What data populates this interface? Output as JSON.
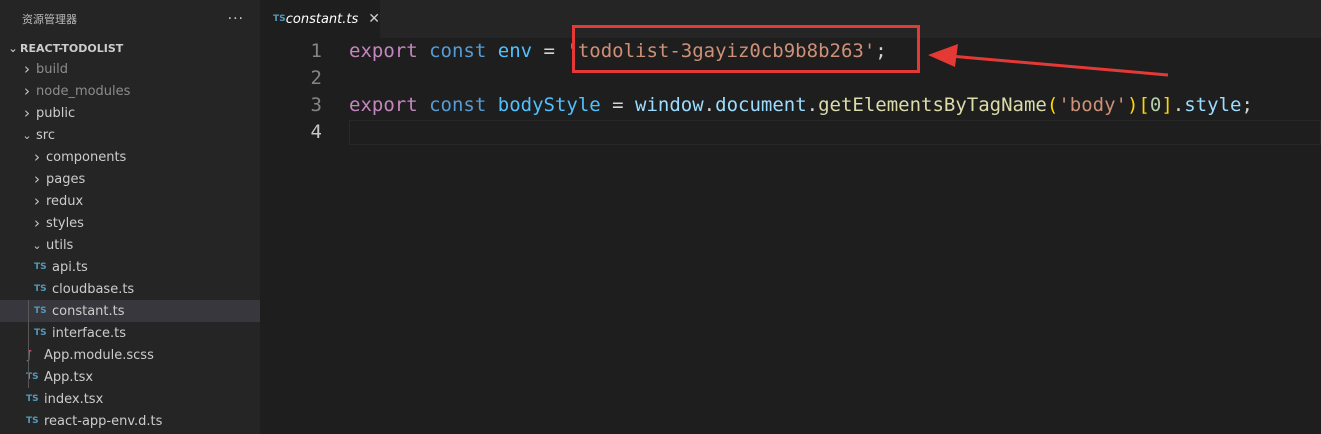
{
  "sidebar": {
    "title": "资源管理器",
    "more": "···",
    "project": "REACT-TODOLIST",
    "items": [
      {
        "label": "build",
        "kind": "folder",
        "open": false
      },
      {
        "label": "node_modules",
        "kind": "folder",
        "open": false
      },
      {
        "label": "public",
        "kind": "folder",
        "open": false
      },
      {
        "label": "src",
        "kind": "folder",
        "open": true
      },
      {
        "label": "components",
        "kind": "folder",
        "open": false
      },
      {
        "label": "pages",
        "kind": "folder",
        "open": false
      },
      {
        "label": "redux",
        "kind": "folder",
        "open": false
      },
      {
        "label": "styles",
        "kind": "folder",
        "open": false
      },
      {
        "label": "utils",
        "kind": "folder",
        "open": true
      },
      {
        "label": "api.ts",
        "kind": "ts"
      },
      {
        "label": "cloudbase.ts",
        "kind": "ts"
      },
      {
        "label": "constant.ts",
        "kind": "ts",
        "selected": true
      },
      {
        "label": "interface.ts",
        "kind": "ts"
      },
      {
        "label": "App.module.scss",
        "kind": "scss"
      },
      {
        "label": "App.tsx",
        "kind": "ts"
      },
      {
        "label": "index.tsx",
        "kind": "ts"
      },
      {
        "label": "react-app-env.d.ts",
        "kind": "ts"
      }
    ]
  },
  "editor": {
    "tab": {
      "badge": "TS",
      "title": "constant.ts",
      "close": "✕"
    },
    "lines": [
      {
        "num": "1",
        "tokens": [
          {
            "t": "export",
            "c": "kw-ex"
          },
          {
            "t": " ",
            "c": "punct"
          },
          {
            "t": "const",
            "c": "kw"
          },
          {
            "t": " ",
            "c": "punct"
          },
          {
            "t": "env",
            "c": "var"
          },
          {
            "t": " = ",
            "c": "punct"
          },
          {
            "t": "'todolist-3gayiz0cb9b8b263'",
            "c": "str"
          },
          {
            "t": ";",
            "c": "punct"
          }
        ]
      },
      {
        "num": "2",
        "tokens": []
      },
      {
        "num": "3",
        "tokens": [
          {
            "t": "export",
            "c": "kw-ex"
          },
          {
            "t": " ",
            "c": "punct"
          },
          {
            "t": "const",
            "c": "kw"
          },
          {
            "t": " ",
            "c": "punct"
          },
          {
            "t": "bodyStyle",
            "c": "var"
          },
          {
            "t": " = ",
            "c": "punct"
          },
          {
            "t": "window",
            "c": "id"
          },
          {
            "t": ".",
            "c": "punct"
          },
          {
            "t": "document",
            "c": "id"
          },
          {
            "t": ".",
            "c": "punct"
          },
          {
            "t": "getElementsByTagName",
            "c": "fn"
          },
          {
            "t": "(",
            "c": "br1"
          },
          {
            "t": "'body'",
            "c": "str"
          },
          {
            "t": ")",
            "c": "br1"
          },
          {
            "t": "[",
            "c": "br1"
          },
          {
            "t": "0",
            "c": "num"
          },
          {
            "t": "]",
            "c": "br1"
          },
          {
            "t": ".",
            "c": "punct"
          },
          {
            "t": "style",
            "c": "id"
          },
          {
            "t": ";",
            "c": "punct"
          }
        ]
      },
      {
        "num": "4",
        "tokens": [],
        "active": true
      }
    ]
  },
  "annotation_color": "#e53935"
}
